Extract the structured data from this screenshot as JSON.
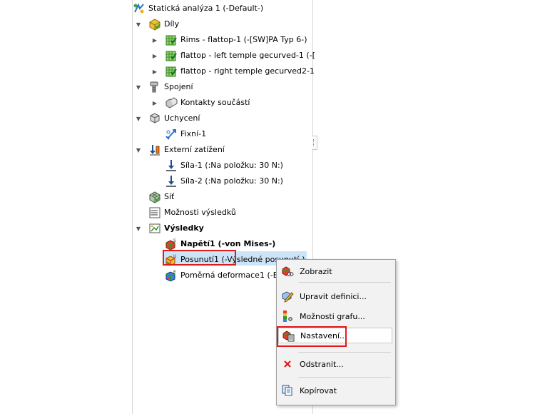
{
  "tree": {
    "root": "Statická analýza 1 (-Default-)",
    "parts_folder": "Díly",
    "parts": [
      "Rims - flattop-1 (-[SW]PA Typ 6-)",
      "flattop - left temple gecurved-1 (-[",
      "flattop - right temple gecurved2-1"
    ],
    "connections_folder": "Spojení",
    "component_contacts": "Kontakty součástí",
    "fixtures_folder": "Uchycení",
    "fixture": "Fixní-1",
    "loads_folder": "Externí zatížení",
    "forces": [
      "Síla-1 (:Na položku: 30 N:)",
      "Síla-2 (:Na položku: 30 N:)"
    ],
    "mesh": "Síť",
    "result_options": "Možnosti výsledků",
    "results_folder": "Výsledky",
    "results": [
      "Napětí1 (-von Mises-)",
      "Posunutí1 (-Výsledné posunutí-)",
      "Poměrná deformace1 (-E"
    ]
  },
  "context_menu": {
    "items": [
      "Zobrazit",
      "Upravit definici...",
      "Možnosti grafu...",
      "Nastavení...",
      "Odstranit...",
      "Kopírovat"
    ]
  },
  "colors": {
    "selection": "#cce4f7",
    "highlight_box": "#e01a1a",
    "menu_bg": "#f2f2f2"
  }
}
